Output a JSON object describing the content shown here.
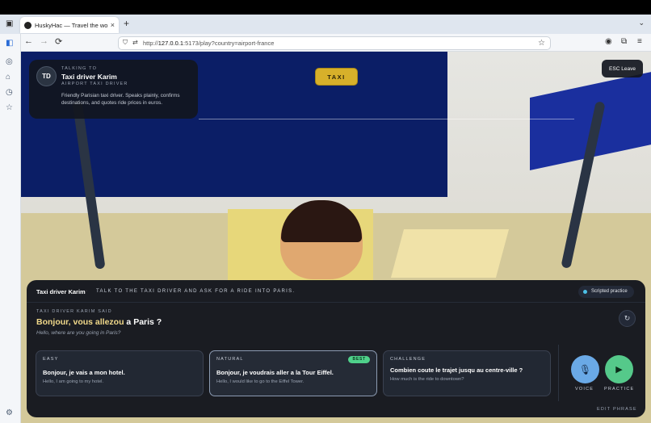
{
  "browser": {
    "tab_title": "HuskyHac — Travel the world. L",
    "tab_close": "×",
    "new_tab": "+",
    "tab_menu": "⌄",
    "url_prefix": "http://",
    "url_host": "127.0.0.1",
    "url_rest": ":5173/play?country=airport-france",
    "back": "←",
    "forward": "→",
    "reload": "⟳",
    "bookmark": "☆"
  },
  "talking_to": {
    "label": "TALKING TO",
    "avatar": "TD",
    "name": "Taxi driver Karim",
    "role": "AIRPORT TAXI DRIVER",
    "description": "Friendly Parisian taxi driver. Speaks plainly, confirms destinations, and quotes ride prices in euros."
  },
  "scene": {
    "sign_text": "TAXI"
  },
  "esc_button": "ESC Leave",
  "panel": {
    "name": "Taxi driver Karim",
    "separator": "·",
    "task": "TALK TO THE TAXI DRIVER AND ASK FOR A RIDE INTO PARIS.",
    "badge": "Scripted practice",
    "said_label": "TAXI DRIVER KARIM SAID",
    "said_hl": "Bonjour, vous allezou",
    "said_rest": " a Paris ?",
    "said_translation": "Hello, where are you going in Paris?",
    "replay_icon": "↻",
    "options": [
      {
        "level": "EASY",
        "french": "Bonjour, je vais a mon hotel.",
        "english": "Hello, I am going to my hotel."
      },
      {
        "level": "NATURAL",
        "french": "Bonjour, je voudrais aller a la Tour Eiffel.",
        "english": "Hello, I would like to go to the Eiffel Tower.",
        "badge": "BEST"
      },
      {
        "level": "CHALLENGE",
        "french": "Combien coute le trajet jusqu au centre-ville ?",
        "english": "How much is the ride to downtown?"
      }
    ],
    "voice_label": "VOICE",
    "practice_label": "PRACTICE",
    "mic_icon": "🎙",
    "play_icon": "▶",
    "edit_label": "EDIT PHRASE"
  },
  "colors": {
    "accent_yellow": "#f1d98a",
    "voice_blue": "#6aa9e6",
    "practice_green": "#55c98a",
    "best_green": "#4fd18b",
    "sign_blue": "#0b1e66"
  }
}
